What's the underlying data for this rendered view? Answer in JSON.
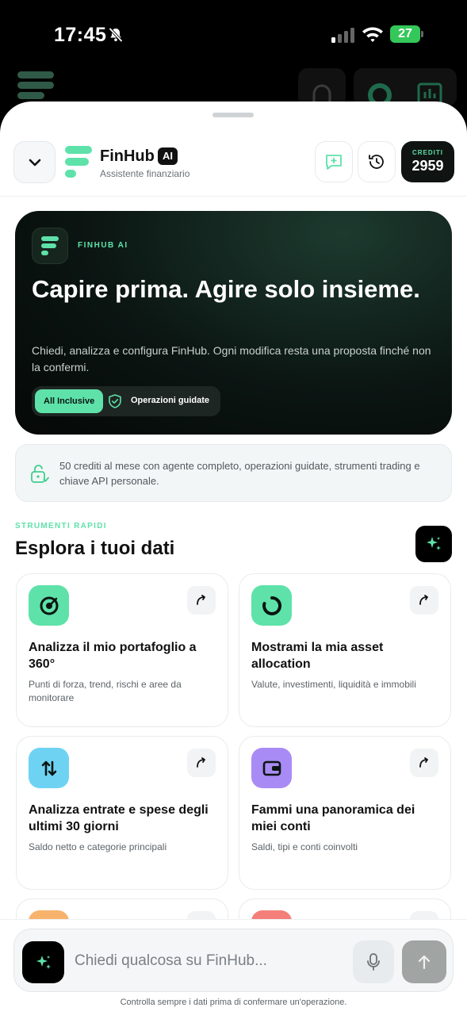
{
  "status_bar": {
    "time": "17:45",
    "battery": "27"
  },
  "header": {
    "brand_name": "FinHub",
    "ai_badge": "AI",
    "subtitle": "Assistente finanziario",
    "credits_label": "CREDITI",
    "credits_value": "2959"
  },
  "hero": {
    "kicker": "FINHUB AI",
    "title": "Capire prima. Agire solo insieme.",
    "description": "Chiedi, analizza e configura FinHub. Ogni modifica resta una proposta finché non la confermi.",
    "pill_active": "All Inclusive",
    "pill_guided": "Operazioni guidate"
  },
  "info": {
    "text": "50 crediti al mese con agente completo, operazioni guidate, strumenti trading e chiave API personale."
  },
  "section": {
    "kicker": "STRUMENTI RAPIDI",
    "title": "Esplora i tuoi dati"
  },
  "cards": [
    {
      "icon": "target-icon",
      "color": "#5ee2a9",
      "title": "Analizza il mio portafoglio a 360°",
      "subtitle": "Punti di forza, trend, rischi e aree da monitorare"
    },
    {
      "icon": "donut-chart-icon",
      "color": "#5ee2a9",
      "title": "Mostrami la mia asset allocation",
      "subtitle": "Valute, investimenti, liquidità e immobili"
    },
    {
      "icon": "swap-arrows-icon",
      "color": "#6ed3f3",
      "title": "Analizza entrate e spese degli ultimi 30 giorni",
      "subtitle": "Saldo netto e categorie principali"
    },
    {
      "icon": "wallet-icon",
      "color": "#a98bf5",
      "title": "Fammi una panoramica dei miei conti",
      "subtitle": "Saldi, tipi e conti coinvolti"
    }
  ],
  "peek_colors": [
    "#f7b36b",
    "#f47f7a"
  ],
  "composer": {
    "placeholder": "Chiedi qualcosa su FinHub...",
    "disclaimer": "Controlla sempre i dati prima di confermare un'operazione."
  },
  "colors": {
    "accent": "#5ee2a9",
    "dark": "#0f1412"
  }
}
